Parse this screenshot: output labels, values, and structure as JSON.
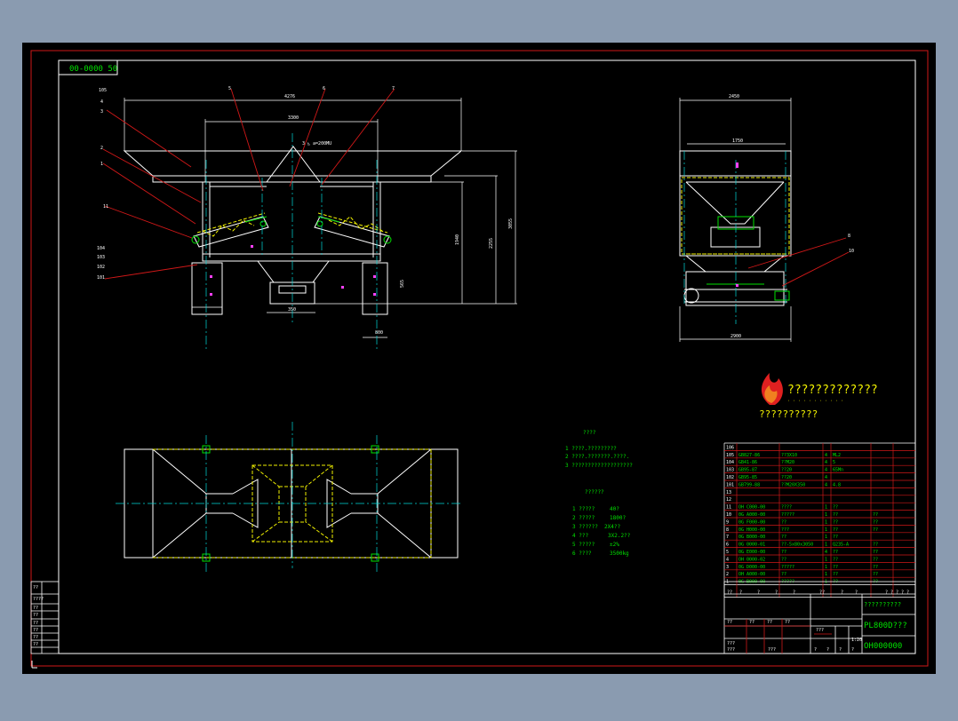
{
  "colors": {
    "background": "#8a9bb0",
    "canvas": "#000000",
    "frame_red": "#d01818",
    "outline_white": "#ffffff",
    "cyan": "#00d8d8",
    "yellow": "#f0f000",
    "green": "#00e000",
    "magenta": "#ff40ff"
  },
  "drawing_number_box": "00-0000 50",
  "front_view": {
    "leaders": [
      "5",
      "6",
      "7",
      "105",
      "4",
      "3",
      "2",
      "1",
      "11",
      "104",
      "103",
      "102",
      "101"
    ],
    "note": "3 ◺ a=200MU"
  },
  "side_view": {
    "leaders": [
      "8",
      "10"
    ]
  },
  "logo": {
    "title": "?????????????",
    "subtitle": "· · · · · · · · · · ·",
    "tagline": "??????????"
  },
  "requirements": {
    "title": "????",
    "items": [
      "1  ????.?????????",
      "2  ????.???????.????.",
      "3  ???????????????????"
    ]
  },
  "params": {
    "title": "??????",
    "rows": [
      {
        "label": "1  ?????",
        "value": "40?"
      },
      {
        "label": "2  ?????",
        "value": "1800?"
      },
      {
        "label": "3  ??????",
        "value": "2X4??"
      },
      {
        "label": "4  ???",
        "value": "3X2.2??"
      },
      {
        "label": "5  ?????",
        "value": "±2%"
      },
      {
        "label": "6  ????",
        "value": "3500kg"
      }
    ]
  },
  "bom": {
    "rows": [
      [
        "106",
        "",
        "",
        "",
        ""
      ],
      [
        "105",
        "GB827-86",
        "??3X10",
        "4",
        "ML2",
        ""
      ],
      [
        "104",
        "GB41-86",
        "??M20",
        "4",
        "5",
        ""
      ],
      [
        "103",
        "GB95-87",
        "??20",
        "4",
        "65Mn",
        ""
      ],
      [
        "102",
        "GB95-85",
        "??20",
        "4",
        "",
        ""
      ],
      [
        "101",
        "GB799-88",
        "??M20X350",
        "4",
        "4.8",
        ""
      ],
      [
        "13",
        "",
        "",
        "",
        "",
        ""
      ],
      [
        "12",
        "",
        "",
        "",
        "",
        ""
      ],
      [
        "11",
        "OH C000-00",
        "????",
        "1",
        "??",
        ""
      ],
      [
        "10",
        "0G A000-00",
        "?????",
        "1",
        "??",
        "??"
      ],
      [
        "9",
        "0G F000-00",
        "??",
        "1",
        "??",
        "??"
      ],
      [
        "8",
        "0G H000-00",
        "???",
        "1",
        "??",
        "??"
      ],
      [
        "7",
        "0G B000-00",
        "??",
        "1",
        "??",
        ""
      ],
      [
        "6",
        "0G 0000-01",
        "??-5x80x3050",
        "1",
        "Q235-A",
        "??"
      ],
      [
        "5",
        "0G E000-00",
        "??",
        "4",
        "??",
        "??"
      ],
      [
        "4",
        "OH 0000-02",
        "??",
        "1",
        "??",
        "??"
      ],
      [
        "3",
        "0G D000-00",
        "?????",
        "1",
        "??",
        "??"
      ],
      [
        "2",
        "OH A000-00",
        "??",
        "1",
        "??",
        "??"
      ],
      [
        "1",
        "0G B000-00",
        "?????",
        "1",
        "??",
        "??"
      ]
    ],
    "header": [
      "??",
      "?",
      "?",
      "?",
      "?",
      "??",
      "?",
      "?",
      "? ? ?",
      "? ?"
    ]
  },
  "title_block": {
    "company": "??????????",
    "name": "PL800D???",
    "code": "OH000000",
    "labels": [
      "??",
      "??",
      "??",
      "??",
      "?",
      "?",
      "?",
      "?",
      "???",
      "???",
      "???",
      "???",
      "??",
      "??",
      "??",
      "??",
      "?",
      "?",
      "?",
      "?"
    ]
  },
  "left_revision": {
    "labels": [
      "??",
      "????",
      "??",
      "??",
      "??",
      "??",
      "??",
      "??"
    ]
  }
}
